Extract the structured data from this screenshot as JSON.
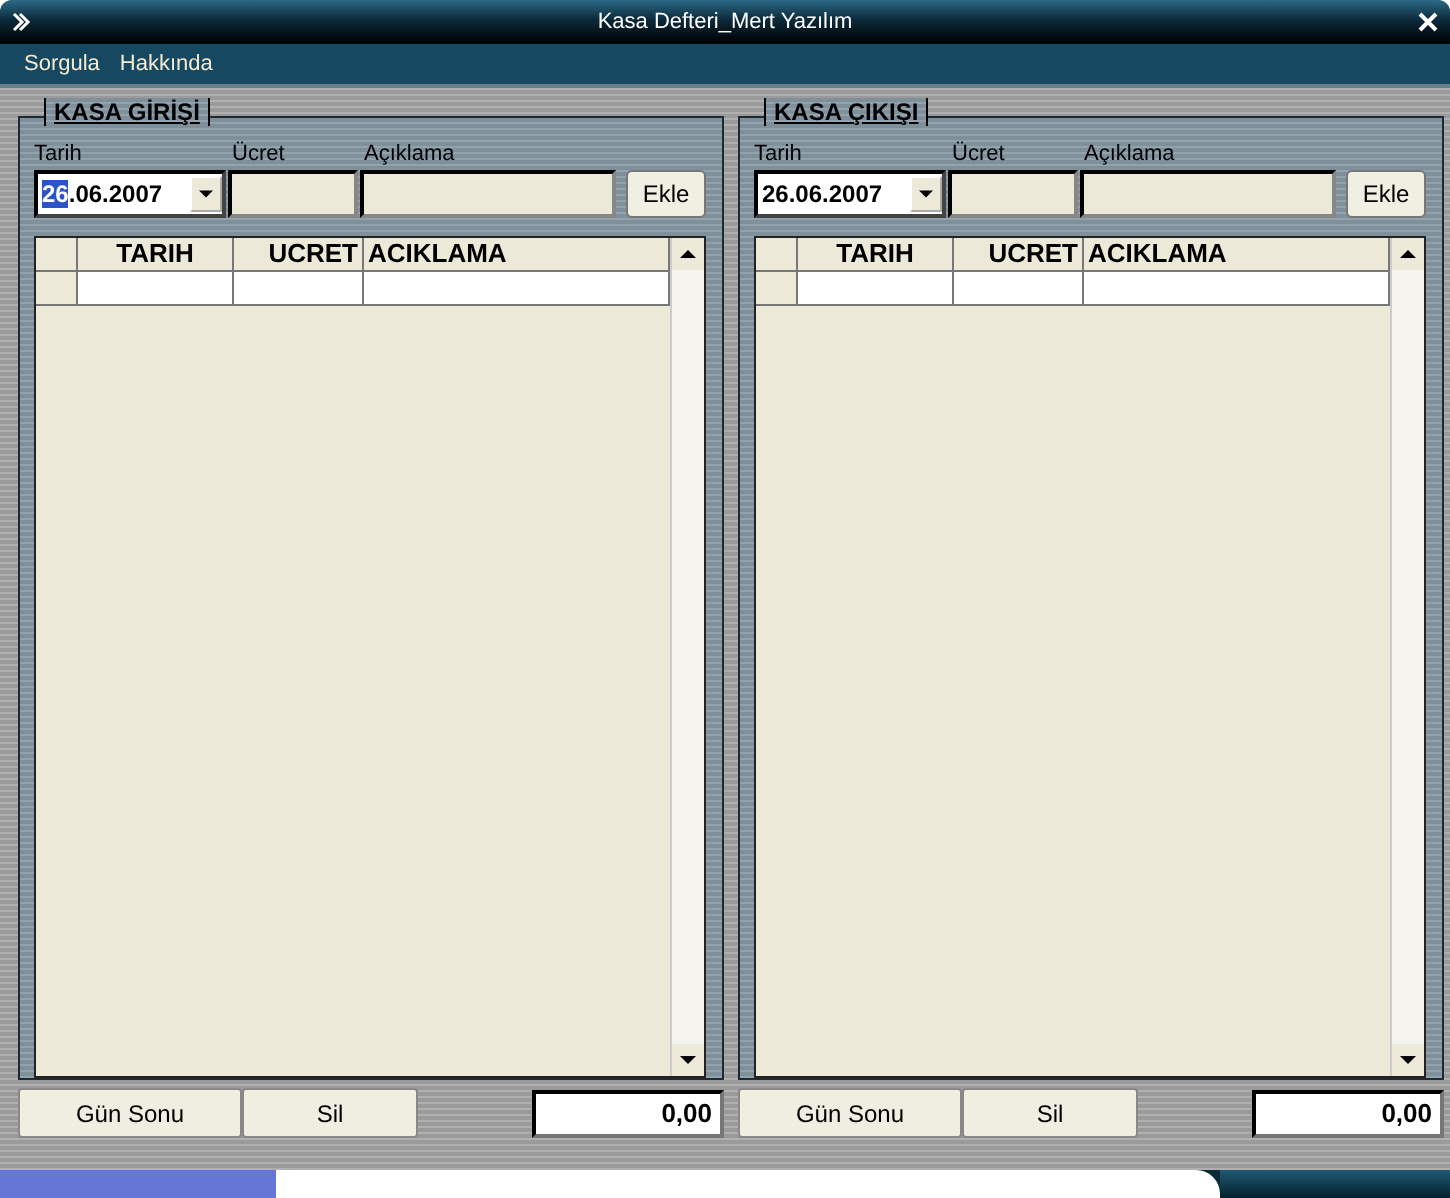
{
  "window": {
    "title": "Kasa Defteri_Mert Yazılım"
  },
  "menu": [
    {
      "label": "Sorgula"
    },
    {
      "label": "Hakkında"
    }
  ],
  "panels": [
    {
      "title": "KASA GİRİŞİ",
      "fields": [
        {
          "kind": "date",
          "label": "Tarih",
          "value": "26.06.2007",
          "focused": true
        },
        {
          "kind": "text",
          "label": "Ücret"
        },
        {
          "kind": "text",
          "label": "Açıklama"
        }
      ],
      "add_button": "Ekle",
      "columns": [
        "TARIH",
        "UCRET",
        "ACIKLAMA"
      ],
      "new_row": true,
      "buttons": [
        "Gün Sonu",
        "Sil"
      ],
      "total": "0,00"
    },
    {
      "title": "KASA ÇIKIŞI",
      "fields": [
        {
          "kind": "date",
          "label": "Tarih",
          "value": "26.06.2007",
          "focused": false
        },
        {
          "kind": "text",
          "label": "Ücret"
        },
        {
          "kind": "text",
          "label": "Açıklama"
        }
      ],
      "add_button": "Ekle",
      "columns": [
        "TARIH",
        "UCRET",
        "ACIKLAMA"
      ],
      "new_row": true,
      "buttons": [
        "Gün Sonu",
        "Sil"
      ],
      "total": "0,00"
    }
  ]
}
